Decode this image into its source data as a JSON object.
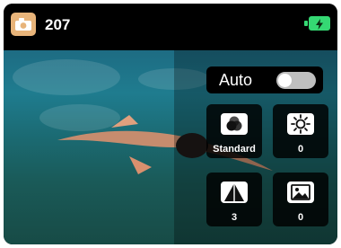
{
  "status_bar": {
    "shot_count": "207",
    "camera_icon": "camera-icon",
    "battery_icon": "battery-charging-icon",
    "accent_color": "#35d873"
  },
  "auto_control": {
    "label": "Auto",
    "state": "off"
  },
  "settings": [
    {
      "name": "color-mode",
      "icon": "color-filter-icon",
      "value": "Standard"
    },
    {
      "name": "brightness",
      "icon": "brightness-icon",
      "value": "0"
    },
    {
      "name": "sharpness",
      "icon": "sharpness-icon",
      "value": "3"
    },
    {
      "name": "image-adjust",
      "icon": "image-icon",
      "value": "0"
    }
  ]
}
